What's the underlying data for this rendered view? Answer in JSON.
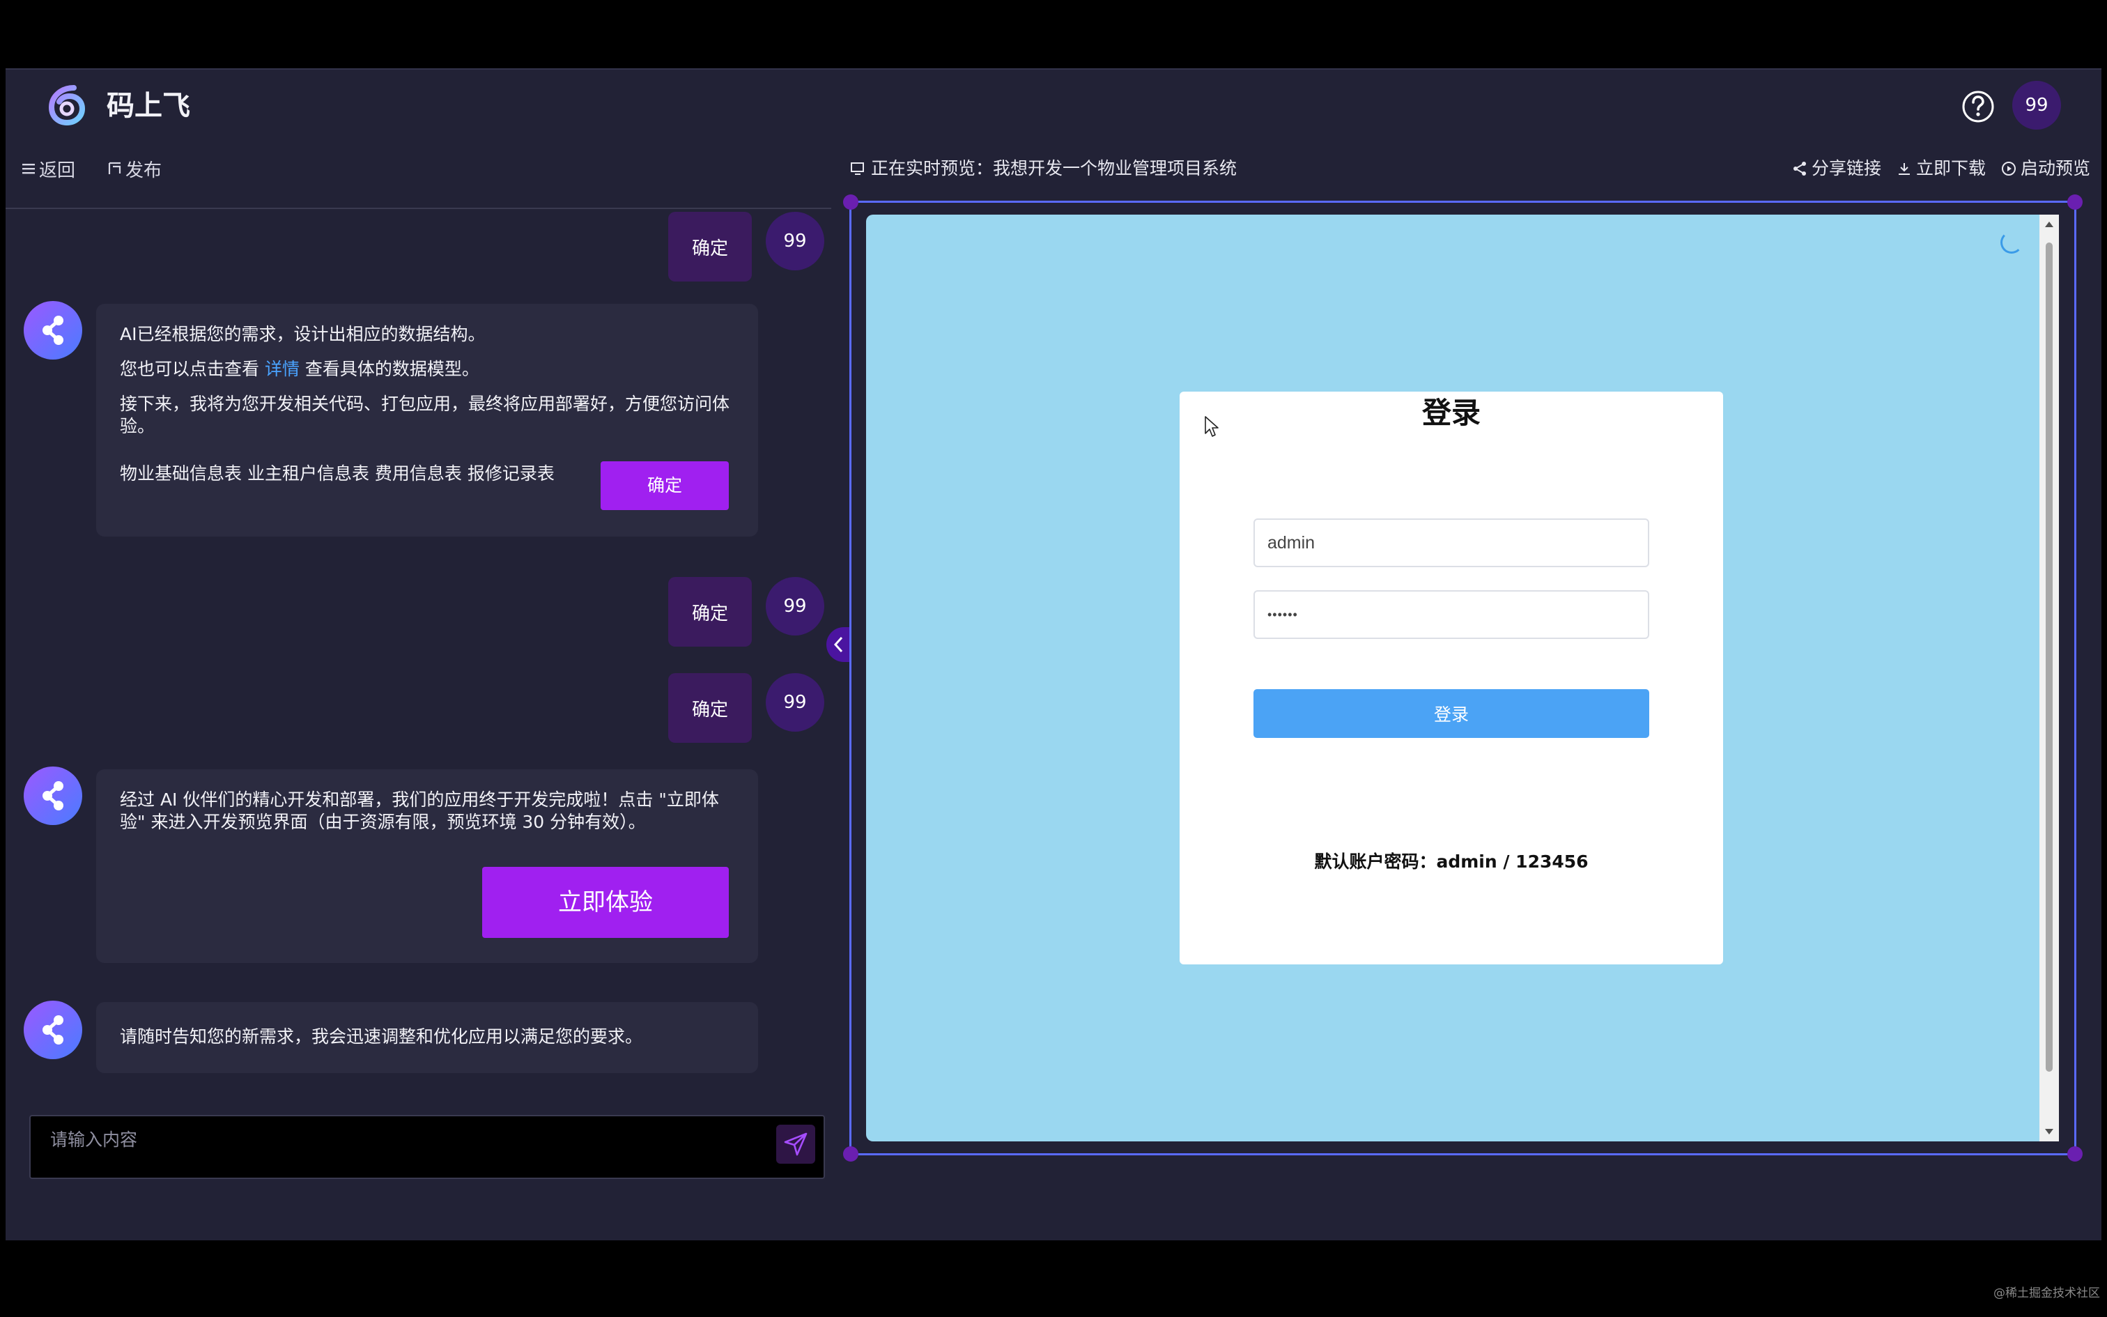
{
  "app": {
    "title": "码上飞"
  },
  "header": {
    "avatar_label": "99"
  },
  "left_toolbar": {
    "back_label": "返回",
    "publish_label": "发布"
  },
  "chat": {
    "messages": [
      {
        "role": "user",
        "text": "确定",
        "avatar": "99"
      },
      {
        "role": "bot",
        "line1": "AI已经根据您的需求，设计出相应的数据结构。",
        "line2_pre": "您也可以点击查看 ",
        "line2_link": "详情",
        "line2_post": " 查看具体的数据模型。",
        "line3": "接下来，我将为您开发相关代码、打包应用，最终将应用部署好，方便您访问体验。",
        "tables": "物业基础信息表 业主租户信息表 费用信息表 报修记录表",
        "button": "确定"
      },
      {
        "role": "user",
        "text": "确定",
        "avatar": "99"
      },
      {
        "role": "user",
        "text": "确定",
        "avatar": "99"
      },
      {
        "role": "bot",
        "text": "经过 AI 伙伴们的精心开发和部署，我们的应用终于开发完成啦！点击 \"立即体验\" 来进入开发预览界面（由于资源有限，预览环境 30 分钟有效）。",
        "button": "立即体验"
      },
      {
        "role": "bot",
        "text": "请随时告知您的新需求，我会迅速调整和优化应用以满足您的要求。"
      }
    ],
    "input_placeholder": "请输入内容"
  },
  "preview": {
    "title": "正在实时预览：我想开发一个物业管理项目系统",
    "share_label": "分享链接",
    "download_label": "立即下载",
    "launch_label": "启动预览",
    "login": {
      "title": "登录",
      "username_value": "admin",
      "password_value": "••••••",
      "button": "登录",
      "default_account": "默认账户密码：admin / 123456"
    }
  },
  "watermark": "@稀土掘金技术社区",
  "colors": {
    "accent": "#a020f0",
    "preview_bg": "#9ad7f0",
    "login_button": "#4ba3f5",
    "app_bg": "#222236"
  }
}
